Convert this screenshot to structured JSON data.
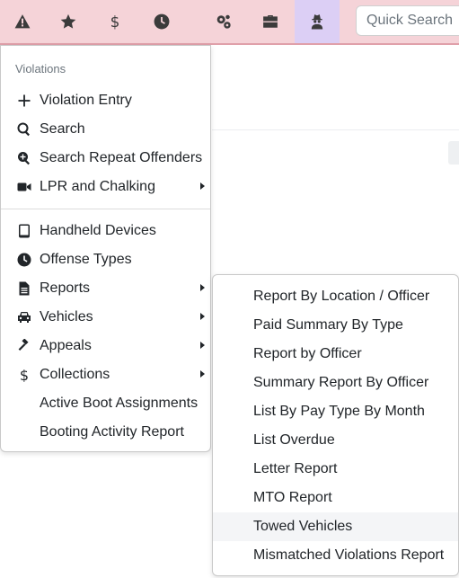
{
  "topbar": {
    "icons": [
      {
        "name": "alert-triangle-icon"
      },
      {
        "name": "star-icon"
      },
      {
        "name": "dollar-icon"
      },
      {
        "name": "clock-icon"
      },
      {
        "name": "gears-icon"
      },
      {
        "name": "briefcase-icon"
      },
      {
        "name": "user-secret-icon",
        "active": true
      }
    ],
    "search_placeholder": "Quick Search"
  },
  "colors": {
    "topbar_bg": "#f5d3d8",
    "active_tab_bg": "#dccff5",
    "hover_bg": "#f4f5f7"
  },
  "menu": {
    "header": "Violations",
    "items": [
      {
        "label": "Violation Entry",
        "icon": "plus-icon"
      },
      {
        "label": "Search",
        "icon": "search-icon"
      },
      {
        "label": "Search Repeat Offenders",
        "icon": "search-plus-icon"
      },
      {
        "label": "LPR and Chalking",
        "icon": "video-camera-icon",
        "submenu": true
      },
      {
        "label": "Handheld Devices",
        "icon": "tablet-icon"
      },
      {
        "label": "Offense Types",
        "icon": "clock-icon"
      },
      {
        "label": "Reports",
        "icon": "file-icon",
        "submenu": true
      },
      {
        "label": "Vehicles",
        "icon": "car-icon",
        "submenu": true
      },
      {
        "label": "Appeals",
        "icon": "gavel-icon",
        "submenu": true
      },
      {
        "label": "Collections",
        "icon": "dollar-icon",
        "submenu": true
      },
      {
        "label": "Active Boot Assignments",
        "icon": ""
      },
      {
        "label": "Booting Activity Report",
        "icon": ""
      }
    ]
  },
  "submenu": {
    "items": [
      {
        "label": "Report By Location / Officer"
      },
      {
        "label": "Paid Summary By Type"
      },
      {
        "label": "Report by Officer"
      },
      {
        "label": "Summary Report By Officer"
      },
      {
        "label": "List By Pay Type By Month"
      },
      {
        "label": "List Overdue"
      },
      {
        "label": "Letter Report"
      },
      {
        "label": "MTO Report"
      },
      {
        "label": "Towed Vehicles",
        "hovered": true
      },
      {
        "label": "Mismatched Violations Report"
      }
    ]
  }
}
